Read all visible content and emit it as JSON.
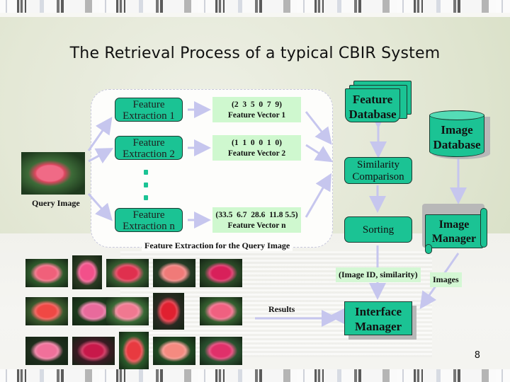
{
  "slide": {
    "title": "The Retrieval Process of a typical CBIR System",
    "page_number": "8"
  },
  "query": {
    "label": "Query Image"
  },
  "extraction_panel": {
    "caption": "Feature Extraction for the Query Image",
    "extractors": [
      {
        "line1": "Feature",
        "line2": "Extraction 1"
      },
      {
        "line1": "Feature",
        "line2": "Extraction 2"
      },
      {
        "line1": "Feature",
        "line2": "Extraction n"
      }
    ],
    "vectors": [
      {
        "values": "(2  3  5  0  7  9)",
        "label": "Feature Vector 1"
      },
      {
        "values": "(1  1  0  0  1  0)",
        "label": "Feature Vector 2"
      },
      {
        "values": "(33.5  6.7  28.6  11.8 5.5)",
        "label": "Feature Vector n"
      }
    ]
  },
  "nodes": {
    "feature_database": {
      "line1": "Feature",
      "line2": "Database"
    },
    "image_database": {
      "line1": "Image",
      "line2": "Database"
    },
    "similarity": {
      "line1": "Similarity",
      "line2": "Comparison"
    },
    "sorting": "Sorting",
    "image_manager": {
      "line1": "Image",
      "line2": "Manager"
    },
    "interface_manager": {
      "line1": "Interface",
      "line2": "Manager"
    }
  },
  "edge_labels": {
    "id_similarity": "(Image ID, similarity)",
    "images": "Images",
    "results": "Results"
  },
  "results": {
    "rows": [
      [
        "pink rose",
        "pink dahlia",
        "red rose bush",
        "salmon rose",
        "magenta phlox"
      ],
      [
        "red hibiscus",
        "pink carnations",
        "pink rose cluster",
        "red rose",
        "pink rose spray"
      ],
      [
        "pink camellia",
        "crimson azalea",
        "red-yellow rose",
        "peach rose",
        "cerise roses"
      ]
    ]
  },
  "colors": {
    "teal": "#1bc394",
    "light_green": "#cff8cf",
    "arrow": "#c6c6ee"
  }
}
